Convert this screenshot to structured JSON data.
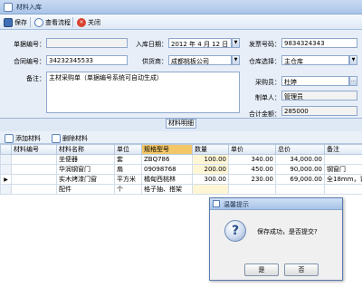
{
  "window": {
    "title": "材料入库"
  },
  "toolbar": {
    "save": "保存",
    "flow": "查看流程",
    "close": "关闭"
  },
  "form": {
    "doc_no_label": "单据编号：",
    "doc_no": "",
    "date_label": "入库日期：",
    "date": "2012 年  4 月 12 日",
    "invoice_label": "发票号码：",
    "invoice": "9834324343",
    "contract_label": "合同编号：",
    "contract": "34232345533",
    "supplier_label": "供货商：",
    "supplier": "成都桃板公司",
    "warehouse_label": "仓库选择：",
    "warehouse": "主仓库",
    "remark_label": "备注：",
    "remark": "主材采购单（单据编号系统可自动生成）",
    "buyer_label": "采购员：",
    "buyer": "杜婷",
    "maker_label": "制单人：",
    "maker": "管理员",
    "total_label": "合计金额：",
    "total": "285000"
  },
  "section": {
    "title": "材料明细"
  },
  "grid_toolbar": {
    "add": "添加材料",
    "delete": "删除材料"
  },
  "grid": {
    "columns": [
      "材料编号",
      "材料名称",
      "单位",
      "规格型号",
      "数量",
      "单价",
      "总价",
      "备注"
    ],
    "rows": [
      {
        "indicator": "",
        "code": "",
        "name": "坐便器",
        "unit": "套",
        "spec": "ZBQ786",
        "qty": "100.00",
        "price": "340.00",
        "total": "34,000.00",
        "note": ""
      },
      {
        "indicator": "",
        "code": "",
        "name": "华润钢窗门",
        "unit": "扇",
        "spec": "09098768",
        "qty": "200.00",
        "price": "450.00",
        "total": "90,000.00",
        "note": "钢窗门"
      },
      {
        "indicator": "▶",
        "code": "",
        "name": "实木烤漆门窗",
        "unit": "平方米",
        "spec": "橘甸西桃林",
        "qty": "300.00",
        "price": "230.00",
        "total": "69,000.00",
        "note": "全18mm，青..."
      },
      {
        "indicator": "",
        "code": "",
        "name": "配件",
        "unit": "个",
        "spec": "格子抽、搭架",
        "qty": "",
        "price": "",
        "total": "",
        "note": ""
      }
    ]
  },
  "dialog": {
    "title": "温馨提示",
    "message": "保存成功，是否提交?",
    "yes": "是",
    "no": "否",
    "icon": "?"
  }
}
